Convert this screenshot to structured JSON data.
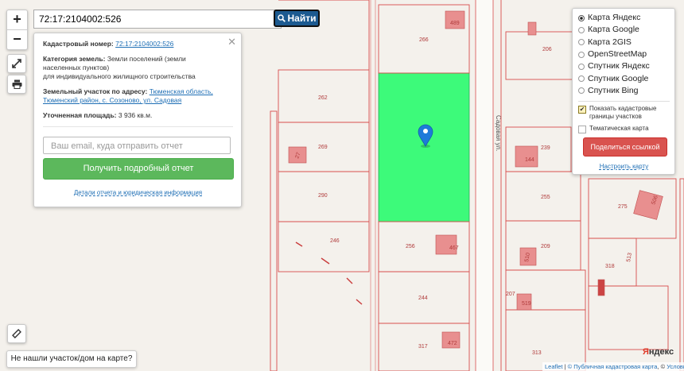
{
  "search": {
    "value": "72:17:2104002:526",
    "find_label": "Найти"
  },
  "info": {
    "cadastral_label": "Кадастровый номер:",
    "cadastral_value": "72:17:2104002:526",
    "category_label": "Категория земель:",
    "category_value": "Земли поселений (земли населенных пунктов)",
    "category_purpose": "для индивидуального жилищного строительства",
    "address_label": "Земельный участок по адресу:",
    "address_value": "Тюменская область, Тюменский район, с. Созоново, ул. Садовая",
    "area_label": "Уточненная площадь:",
    "area_value": "3 936 кв.м.",
    "email_placeholder": "Ваш email, куда отправить отчет",
    "report_button": "Получить подробный отчет",
    "details_link": "Детали отчета и юридическая информация"
  },
  "layers": {
    "options": [
      {
        "label": "Карта Яндекс",
        "selected": true
      },
      {
        "label": "Карта Google",
        "selected": false
      },
      {
        "label": "Карта 2GIS",
        "selected": false
      },
      {
        "label": "OpenStreetMap",
        "selected": false
      },
      {
        "label": "Спутник Яндекс",
        "selected": false
      },
      {
        "label": "Спутник Google",
        "selected": false
      },
      {
        "label": "Спутник Bing",
        "selected": false
      }
    ],
    "show_cadastral": "Показать кадастровые границы участков",
    "show_cadastral_checked": true,
    "thematic": "Тематическая карта",
    "thematic_checked": false,
    "share_button": "Поделиться ссылкой",
    "adjust_link": "Настроить карту"
  },
  "controls": {
    "zoom_in": "+",
    "zoom_out": "−"
  },
  "not_found": "Не нашли участок/дом на карте?",
  "map": {
    "street": "Садовая ул.",
    "plots": [
      "266",
      "206",
      "262",
      "269",
      "239",
      "290",
      "255",
      "275",
      "246",
      "256",
      "209",
      "318",
      "207",
      "244",
      "317",
      "313"
    ],
    "house_numbers": [
      "489",
      "27",
      "144",
      "506",
      "467",
      "510",
      "513",
      "519",
      "472"
    ],
    "highlight_color": "#3dfa7a",
    "boundary_color": "#d84d4d"
  },
  "attribution": {
    "leaflet": "Leaflet",
    "sep": "|",
    "pkk": "© Публичная кадастровая карта",
    "copy": "©",
    "yandex_terms": "Условия использования"
  },
  "brand": {
    "yandex_first": "Я",
    "yandex_rest": "ндекс"
  }
}
